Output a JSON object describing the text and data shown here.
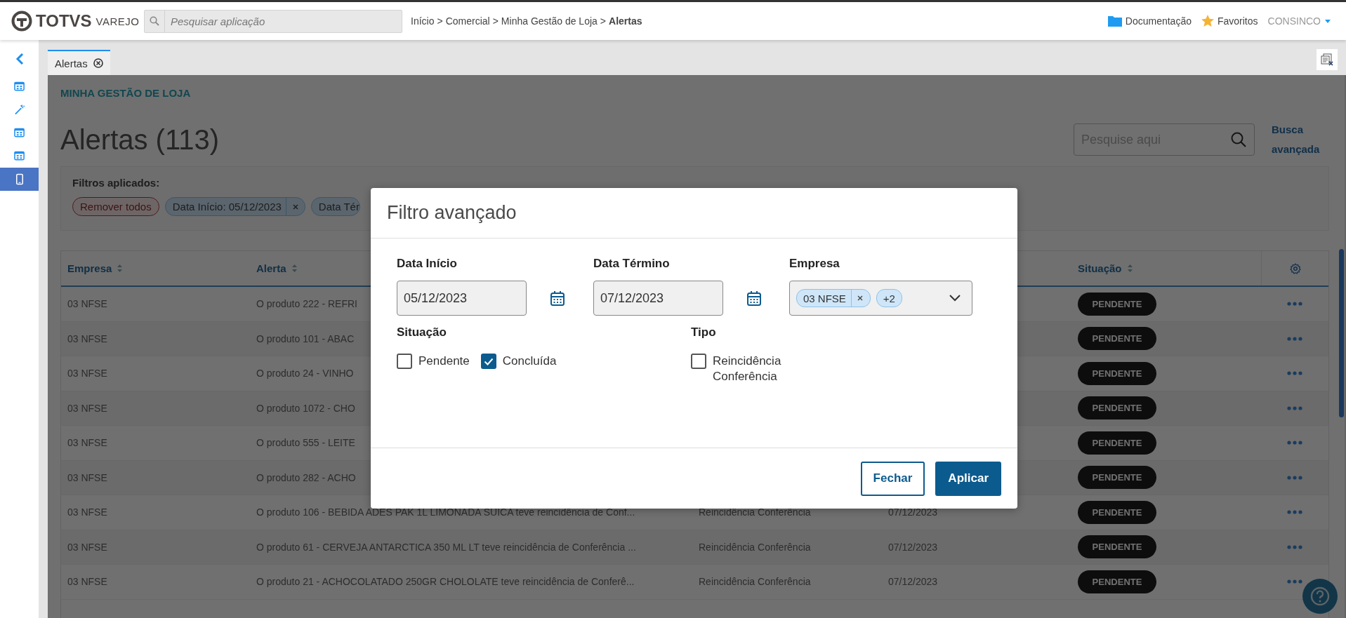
{
  "header": {
    "logo": "TOTVS",
    "logo_sub": "VAREJO",
    "search": {
      "placeholder": "Pesquisar aplicação"
    },
    "breadcrumb": {
      "separator": ">",
      "items": [
        {
          "label": "Início",
          "current": false
        },
        {
          "label": "Comercial",
          "current": false
        },
        {
          "label": "Minha Gestão de Loja",
          "current": false
        },
        {
          "label": "Alertas",
          "current": true
        }
      ]
    },
    "links": [
      {
        "kind": "folder",
        "label": "Documentação"
      },
      {
        "kind": "star",
        "label": "Favoritos"
      }
    ],
    "user": "CONSINCO"
  },
  "sidebar": {
    "items": [
      {
        "kind": "table",
        "selected": false
      },
      {
        "kind": "wand",
        "selected": false
      },
      {
        "kind": "table",
        "selected": false
      },
      {
        "kind": "table",
        "selected": false
      },
      {
        "kind": "phone",
        "selected": true
      }
    ]
  },
  "tabs": [
    {
      "label": "Alertas",
      "selected": true
    }
  ],
  "page": {
    "section": "MINHA GESTÃO DE LOJA",
    "title": "Alertas (113)",
    "search": {
      "placeholder": "Pesquise aqui"
    },
    "advanced_search": "Busca avançada",
    "filters": {
      "label": "Filtros aplicados:",
      "chips": [
        {
          "kind": "remove_all",
          "label": "Remover todos",
          "removable": false
        },
        {
          "kind": "filter",
          "label": "Data Início: 05/12/2023",
          "removable": true
        },
        {
          "kind": "filter",
          "label": "Data Tér",
          "removable": false
        }
      ]
    }
  },
  "table": {
    "columns": [
      {
        "kind": "sort",
        "label": "Empresa"
      },
      {
        "kind": "sort",
        "label": "Alerta"
      },
      {
        "kind": "blank"
      },
      {
        "kind": "blank"
      },
      {
        "kind": "sort",
        "label": "Situação"
      },
      {
        "kind": "settings"
      }
    ],
    "rows": [
      {
        "empresa": "03 NFSE",
        "alerta": "O produto 222 - REFRI",
        "situacao": "PENDENTE"
      },
      {
        "empresa": "03 NFSE",
        "alerta": "O produto 101 - ABAC",
        "situacao": "PENDENTE"
      },
      {
        "empresa": "03 NFSE",
        "alerta": "O produto 24 - VINHO",
        "situacao": "PENDENTE"
      },
      {
        "empresa": "03 NFSE",
        "alerta": "O produto 1072 - CHO",
        "situacao": "PENDENTE"
      },
      {
        "empresa": "03 NFSE",
        "alerta": "O produto 555 - LEITE",
        "situacao": "PENDENTE"
      },
      {
        "empresa": "03 NFSE",
        "alerta": "O produto 282 - ACHO",
        "situacao": "PENDENTE"
      },
      {
        "empresa": "03 NFSE",
        "alerta": "O produto 106 - BEBIDA ADES PAK 1L LIMONADA SUICA teve reincidência de Conf...",
        "tipo": "Reincidência Conferência",
        "data": "07/12/2023",
        "situacao": "PENDENTE"
      },
      {
        "empresa": "03 NFSE",
        "alerta": "O produto 61 - CERVEJA ANTARCTICA 350 ML LT teve reincidência de Conferência ...",
        "tipo": "Reincidência Conferência",
        "data": "07/12/2023",
        "situacao": "PENDENTE"
      },
      {
        "empresa": "03 NFSE",
        "alerta": "O produto 21 - ACHOCOLATADO 250GR CHOLOLATE teve reincidência de Conferê...",
        "tipo": "Reincidência Conferência",
        "data": "07/12/2023",
        "situacao": "PENDENTE"
      }
    ]
  },
  "modal": {
    "title": "Filtro avançado",
    "date_fields": [
      {
        "label": "Data Início",
        "value": "05/12/2023"
      },
      {
        "label": "Data Término",
        "value": "07/12/2023"
      }
    ],
    "empresa": {
      "label": "Empresa",
      "chips": [
        {
          "label": "03 NFSE",
          "removable": true
        },
        {
          "label": "+2",
          "removable": false
        }
      ]
    },
    "situacao": {
      "label": "Situação",
      "options": [
        {
          "label": "Pendente",
          "checked": false
        },
        {
          "label": "Concluída",
          "checked": true
        }
      ]
    },
    "tipo": {
      "label": "Tipo",
      "options": [
        {
          "label": "Reincidência Conferência",
          "checked": false
        }
      ]
    },
    "buttons": [
      {
        "kind": "secondary",
        "label": "Fechar"
      },
      {
        "kind": "primary",
        "label": "Aplicar"
      }
    ]
  }
}
